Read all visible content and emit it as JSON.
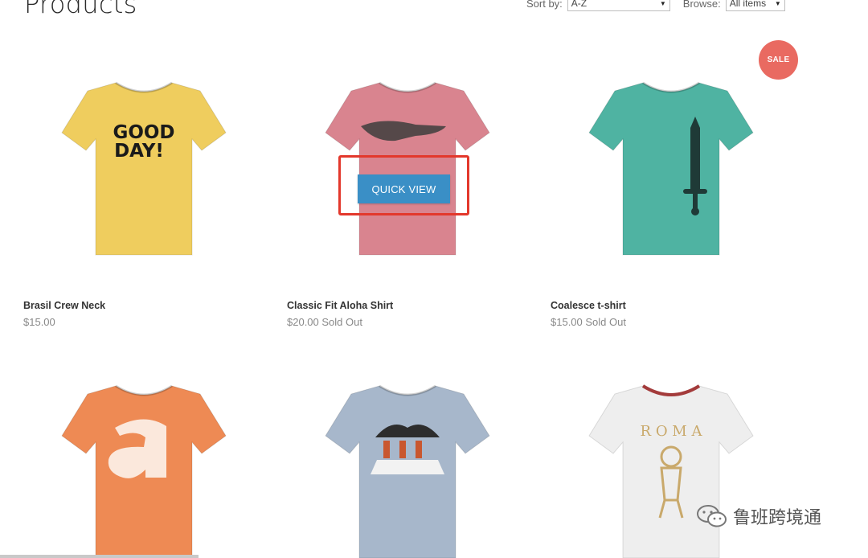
{
  "page": {
    "title": "Products"
  },
  "toolbar": {
    "sort_label": "Sort by:",
    "sort_value": "A-Z",
    "browse_label": "Browse:",
    "browse_value": "All items"
  },
  "products": [
    {
      "name": "Brasil Crew Neck",
      "price": "$15.00",
      "shirt_color": "#efcd5e",
      "graphic": "good-day-text"
    },
    {
      "name": "Classic Fit Aloha Shirt",
      "price": "$20.00 Sold Out",
      "shirt_color": "#d9848f",
      "graphic": "crocodile"
    },
    {
      "name": "Coalesce t-shirt",
      "price": "$15.00 Sold Out",
      "shirt_color": "#4fb3a2",
      "graphic": "pencil-sword",
      "badge": "SALE"
    },
    {
      "name": "",
      "price": "",
      "shirt_color": "#ee8a54",
      "graphic": "letter-a"
    },
    {
      "name": "",
      "price": "",
      "shirt_color": "#a7b7cb",
      "graphic": "crosswalk"
    },
    {
      "name": "",
      "price": "",
      "shirt_color": "#eeeeee",
      "graphic": "roma"
    }
  ],
  "good_day_text": [
    "GOOD",
    "DAY!"
  ],
  "roma_text": "R O M A",
  "quick_view": {
    "label": "QUICK VIEW"
  },
  "watermark": {
    "text": "鲁班跨境通",
    "icon": "wechat-icon"
  },
  "colors": {
    "sale_badge": "#e96a61",
    "quick_view_button": "#3a8fc6",
    "highlight_box": "#e3382c"
  }
}
